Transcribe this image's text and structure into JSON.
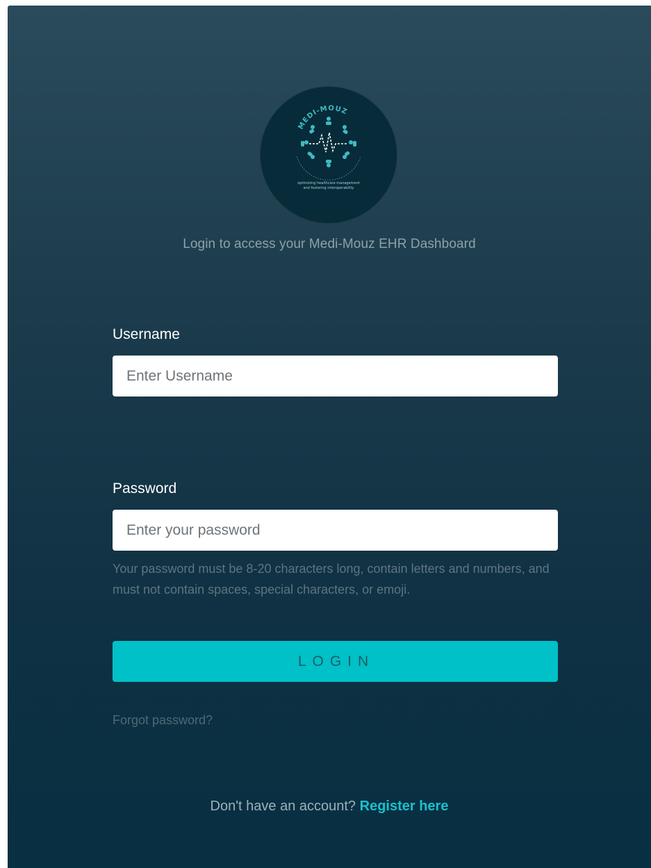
{
  "logo": {
    "brand": "MEDI-MOUZ",
    "tagline": "optimizing healthcare management and fostering interoperability",
    "colors": {
      "background": "#072b38",
      "accent": "#3fbac4"
    }
  },
  "subtitle": "Login to access your Medi-Mouz EHR Dashboard",
  "form": {
    "username": {
      "label": "Username",
      "placeholder": "Enter Username",
      "value": ""
    },
    "password": {
      "label": "Password",
      "placeholder": "Enter your password",
      "value": "",
      "hint": "Your password must be 8-20 characters long, contain letters and numbers, and must not contain spaces, special characters, or emoji."
    },
    "login_label": "LOGIN"
  },
  "links": {
    "forgot": "Forgot password?",
    "register_prompt": "Don't have an account?",
    "register": "Register here"
  },
  "colors": {
    "accent": "#00c0c8",
    "link": "#19c1cc",
    "panel_top": "#2a4b5b",
    "panel_bottom": "#073042"
  }
}
